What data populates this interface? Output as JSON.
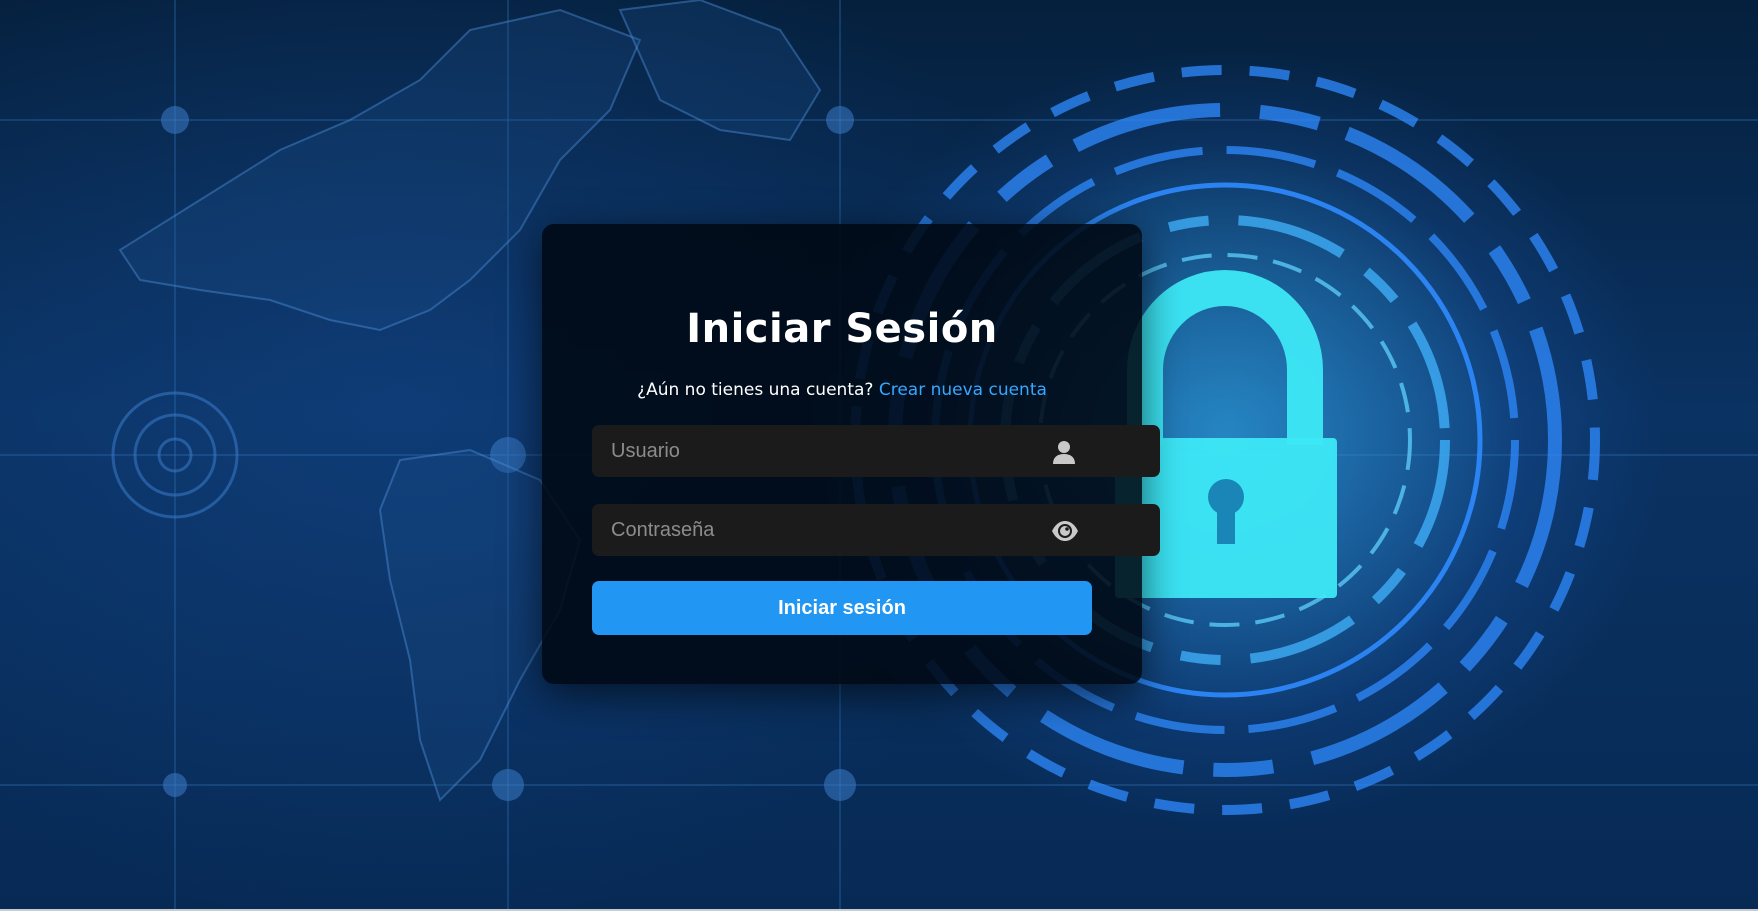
{
  "login": {
    "title": "Iniciar Sesión",
    "prompt": "¿Aún no tienes una cuenta?",
    "create_account_link": "Crear nueva cuenta",
    "username_placeholder": "Usuario",
    "password_placeholder": "Contraseña",
    "submit_label": "Iniciar sesión"
  },
  "icons": {
    "username": "user-icon",
    "password": "eye-icon"
  },
  "colors": {
    "accent": "#2196f3",
    "link": "#36a7ff",
    "card_background": "#00080f",
    "input_background": "#1b1b1b",
    "lock_glow": "#3de8f5"
  }
}
